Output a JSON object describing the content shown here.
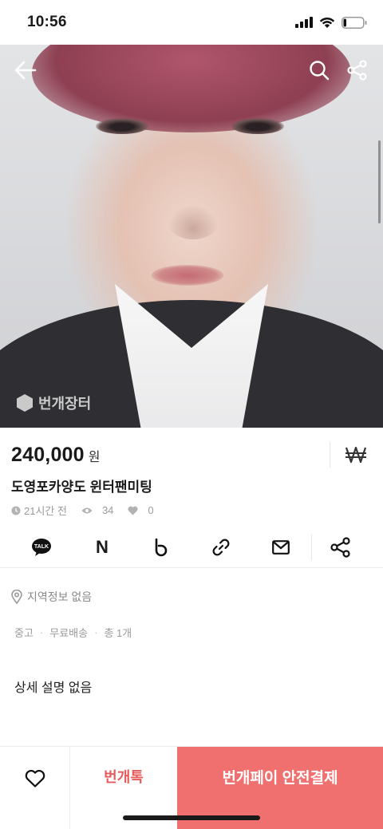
{
  "status_bar": {
    "time": "10:56",
    "battery_level": 0.15
  },
  "hero": {
    "watermark": "번개장터",
    "image_subject": "portrait photo"
  },
  "product": {
    "price": "240,000",
    "price_unit": "원",
    "title": "도영포카양도 윈터팬미팅",
    "time_ago": "21시간 전",
    "views": "34",
    "likes": "0"
  },
  "share": {
    "kakao_label": "TALK",
    "naver_label": "N",
    "band_label": "b"
  },
  "details": {
    "location": "지역정보 없음",
    "tags": [
      "중고",
      "무료배송",
      "총 1개"
    ],
    "tag_separator": "·",
    "description": "상세 설명 없음"
  },
  "bottom_bar": {
    "talk_label": "번개톡",
    "pay_label": "번개페이 안전결제"
  },
  "colors": {
    "accent": "#f07070",
    "accent_text": "#e65c5c"
  }
}
